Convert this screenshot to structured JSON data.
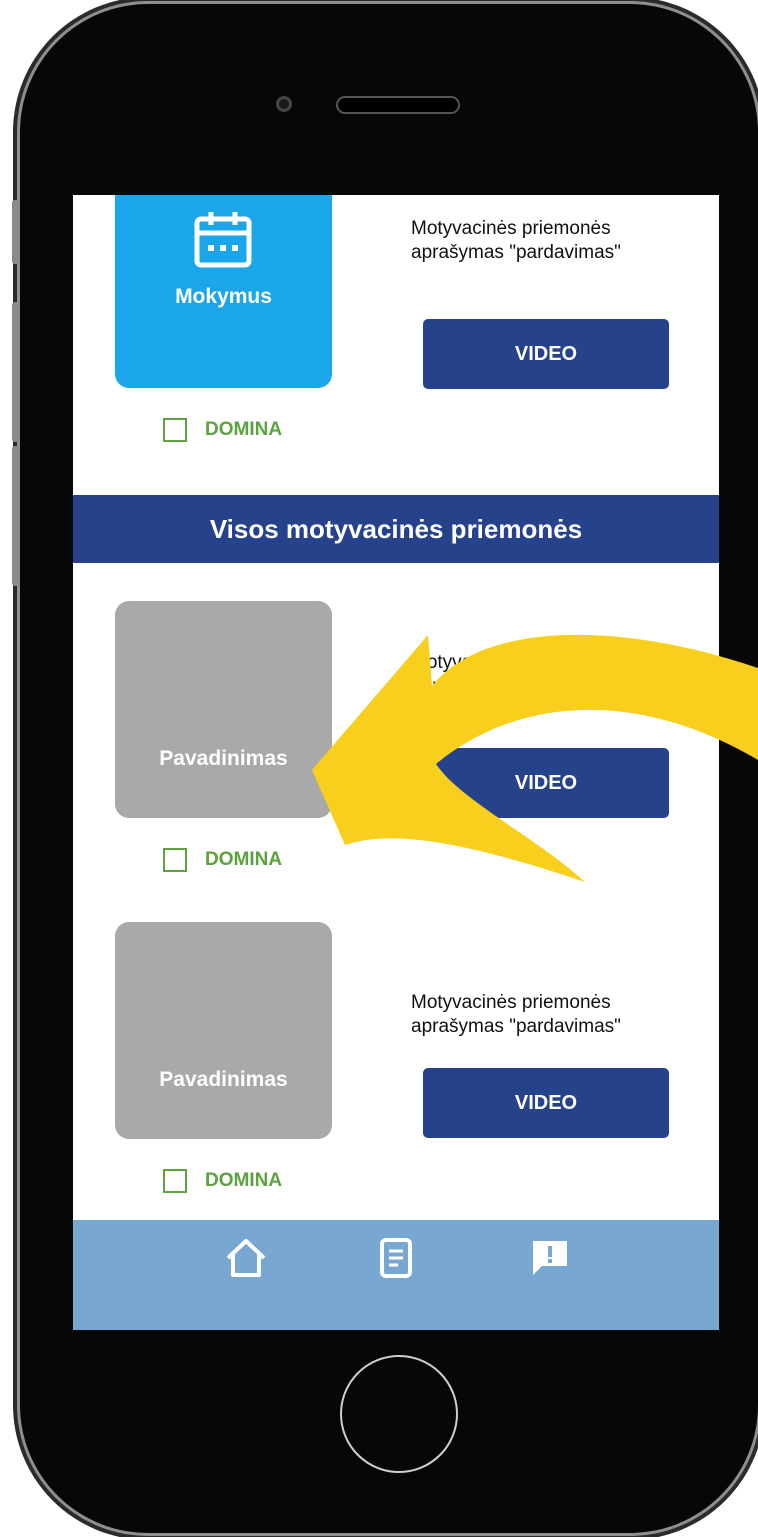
{
  "colors": {
    "primary": "#26428b",
    "accent_blue": "#1ba6ea",
    "card_gray": "#a9a9a9",
    "check_green": "#5aa33d",
    "nav_bar": "#78a8d2",
    "arrow_yellow": "#f7cf1c"
  },
  "featured": {
    "icon": "calendar-icon",
    "card_label": "Mokymus",
    "description_line1": "Motyvacinės priemonės",
    "description_line2": "aprašymas \"pardavimas\"",
    "video_label": "VIDEO",
    "checkbox_label": "DOMINA"
  },
  "section": {
    "title": "Visos motyvacinės priemonės"
  },
  "items": [
    {
      "card_label": "Pavadinimas",
      "description_line1": "Motyvacinės priemonės",
      "description_line2": "aprašymas \"pardavimas\"",
      "video_label": "VIDEO",
      "checkbox_label": "DOMINA"
    },
    {
      "card_label": "Pavadinimas",
      "description_line1": "Motyvacinės priemonės",
      "description_line2": "aprašymas \"pardavimas\"",
      "video_label": "VIDEO",
      "checkbox_label": "DOMINA"
    }
  ],
  "bottom_nav": {
    "items": [
      "home-icon",
      "document-icon",
      "alert-message-icon"
    ]
  }
}
